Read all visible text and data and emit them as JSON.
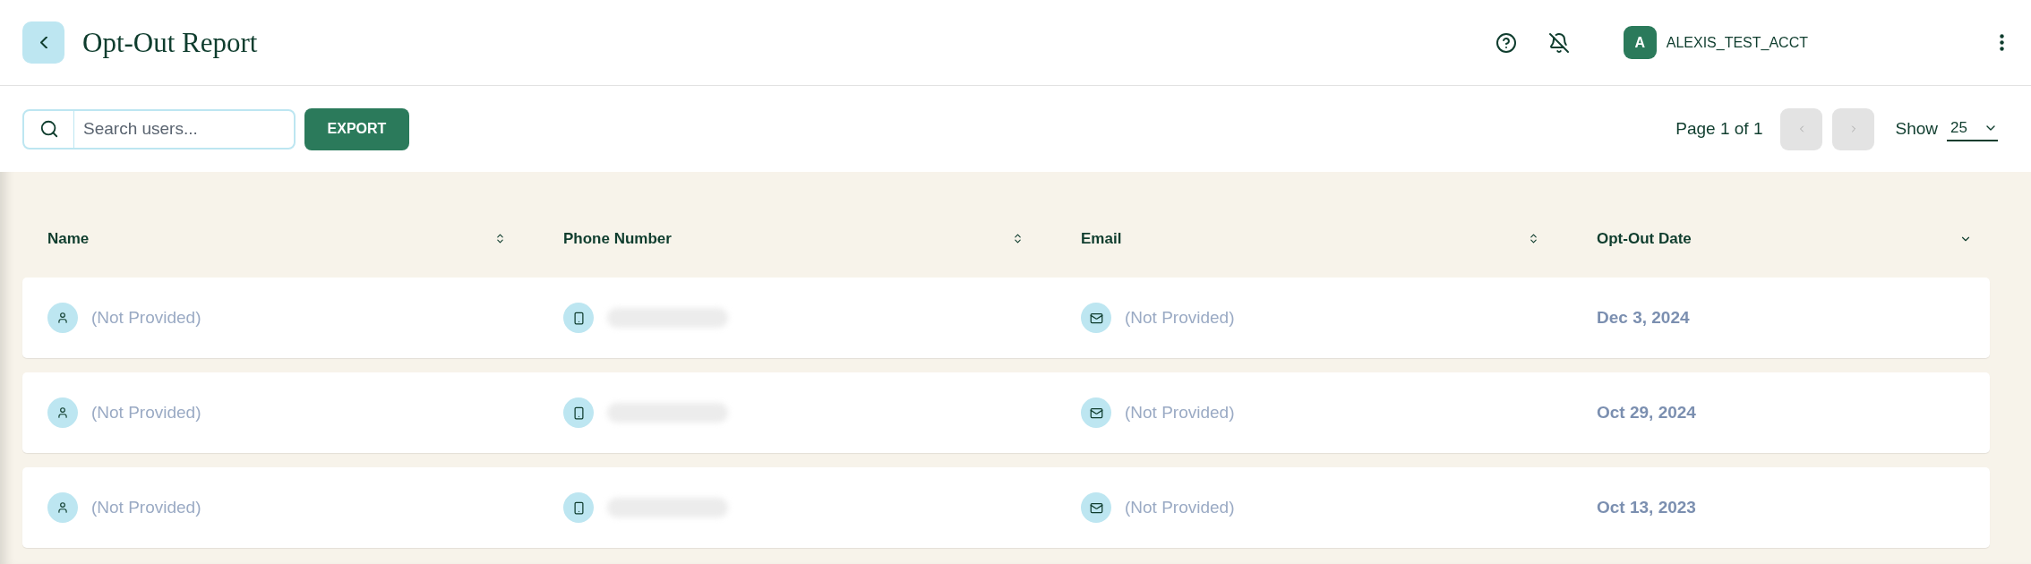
{
  "header": {
    "title": "Opt-Out Report",
    "user": {
      "initial": "A",
      "name": "ALEXIS_TEST_ACCT"
    }
  },
  "toolbar": {
    "search": {
      "placeholder": "Search users..."
    },
    "export_button": "EXPORT",
    "pagination": {
      "label": "Page 1 of 1",
      "prev_disabled": true,
      "next_disabled": true
    },
    "page_size": {
      "label": "Show",
      "value": "25"
    }
  },
  "table": {
    "columns": [
      {
        "label": "Name",
        "kind": "sortable"
      },
      {
        "label": "Phone Number",
        "kind": "sortable"
      },
      {
        "label": "Email",
        "kind": "sortable"
      },
      {
        "label": "Opt-Out Date",
        "kind": "sorted"
      }
    ],
    "rows": [
      {
        "name": "(Not Provided)",
        "phone_redacted": true,
        "email": "(Not Provided)",
        "opt_out_date": "Dec 3, 2024"
      },
      {
        "name": "(Not Provided)",
        "phone_redacted": true,
        "email": "(Not Provided)",
        "opt_out_date": "Oct 29, 2024"
      },
      {
        "name": "(Not Provided)",
        "phone_redacted": true,
        "email": "(Not Provided)",
        "opt_out_date": "Oct 13, 2023"
      }
    ]
  }
}
